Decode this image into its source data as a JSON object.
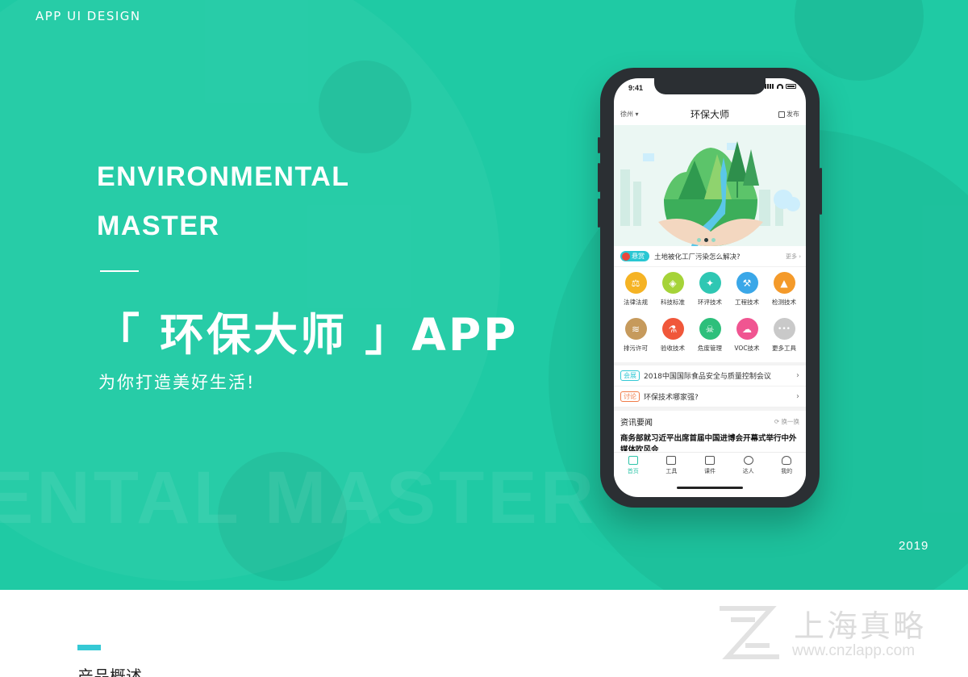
{
  "header": {
    "tag": "APP UI DESIGN"
  },
  "hero": {
    "title_line1": "ENVIRONMENTAL",
    "title_line2": "MASTER",
    "title_cn": "「 环保大师 」APP",
    "slogan": "为你打造美好生活!",
    "bg_text": "ENTAL MASTER",
    "year": "2019",
    "colors": {
      "background": "#1fcaa4",
      "accent": "#35c9d5"
    }
  },
  "phone": {
    "status": {
      "time": "9:41"
    },
    "nav": {
      "city": "徐州 ▾",
      "title": "环保大师",
      "publish": "发布"
    },
    "banner": {
      "dots_count": 3,
      "active_dot": 1
    },
    "reward": {
      "tag": "悬赏",
      "text": "土地被化工厂污染怎么解决?",
      "more": "更多 ›"
    },
    "tools": [
      {
        "label": "法律法规",
        "icon": "scale-icon",
        "glyph": "⚖",
        "color": "#f5b324"
      },
      {
        "label": "科技标准",
        "icon": "shield-icon",
        "glyph": "◈",
        "color": "#a5d338"
      },
      {
        "label": "环评技术",
        "icon": "satellite-icon",
        "glyph": "✦",
        "color": "#2fc7b3"
      },
      {
        "label": "工程技术",
        "icon": "excavator-icon",
        "glyph": "⚒",
        "color": "#3aa7e8"
      },
      {
        "label": "检测技术",
        "icon": "flask-icon",
        "glyph": "▲",
        "color": "#f49a2a"
      },
      {
        "label": "排污许可",
        "icon": "drain-icon",
        "glyph": "≋",
        "color": "#c69a5c"
      },
      {
        "label": "验收技术",
        "icon": "beaker-icon",
        "glyph": "⚗",
        "color": "#f0573a"
      },
      {
        "label": "危废管理",
        "icon": "hazard-icon",
        "glyph": "☠",
        "color": "#2dbf7b"
      },
      {
        "label": "VOC技术",
        "icon": "cloud-icon",
        "glyph": "☁",
        "color": "#f05591"
      },
      {
        "label": "更多工具",
        "icon": "more-icon",
        "glyph": "•••",
        "color": "#c9c9c9"
      }
    ],
    "news_lines": [
      {
        "tag": "会展",
        "text": "2018中国国际食品安全与质量控制会议",
        "color": "#35c9d5"
      },
      {
        "tag": "讨论",
        "text": "环保技术哪家强?",
        "color": "#f07b48"
      }
    ],
    "info": {
      "title": "资讯要闻",
      "refresh": "换一换",
      "headline": "商务部就习近平出席首届中国进博会开幕式举行中外媒体吹风会"
    },
    "tabs": [
      {
        "label": "首页",
        "icon": "home-icon"
      },
      {
        "label": "工具",
        "icon": "toolbox-icon"
      },
      {
        "label": "课件",
        "icon": "courseware-icon"
      },
      {
        "label": "达人",
        "icon": "expert-icon"
      },
      {
        "label": "我的",
        "icon": "profile-icon"
      }
    ]
  },
  "section": {
    "title": "产品概述"
  },
  "watermark": {
    "name": "上海真略",
    "url": "www.cnzlapp.com"
  }
}
